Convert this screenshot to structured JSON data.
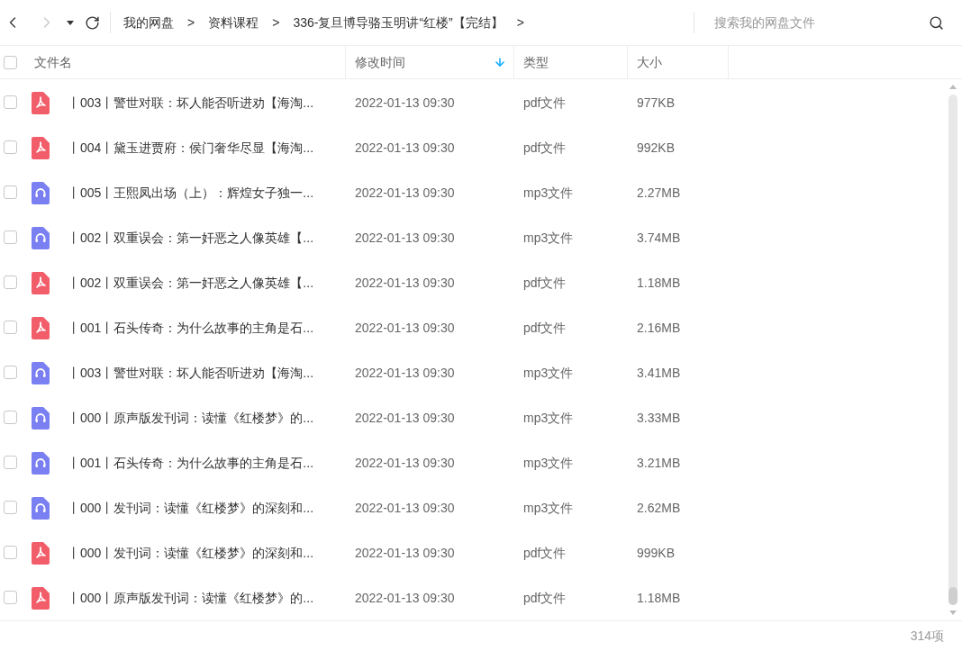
{
  "toolbar": {
    "back": {
      "disabled": false
    },
    "forward": {
      "disabled": true
    },
    "breadcrumbs": [
      {
        "label": "我的网盘",
        "separator": ">"
      },
      {
        "label": "资料课程",
        "separator": ">"
      },
      {
        "label": "336-复旦博导骆玉明讲“红楼”【完结】",
        "separator": ">"
      }
    ],
    "search": {
      "placeholder": "搜索我的网盘文件"
    }
  },
  "table": {
    "select_all": {
      "checked": false
    },
    "columns": [
      {
        "label": "文件名",
        "sorted": false
      },
      {
        "label": "修改时间",
        "sorted": true
      },
      {
        "label": "类型",
        "sorted": false
      },
      {
        "label": "大小",
        "sorted": false
      }
    ],
    "rows": [
      {
        "kind": "pdf",
        "checked": false,
        "name": "丨003丨警世对联：坏人能否听进劝【海淘...",
        "modified": "2022-01-13 09:30",
        "type": "pdf文件",
        "size": "977KB"
      },
      {
        "kind": "pdf",
        "checked": false,
        "name": "丨004丨黛玉进贾府：侯门奢华尽显【海淘...",
        "modified": "2022-01-13 09:30",
        "type": "pdf文件",
        "size": "992KB"
      },
      {
        "kind": "audio",
        "checked": false,
        "name": "丨005丨王熙凤出场（上）：辉煌女子独一...",
        "modified": "2022-01-13 09:30",
        "type": "mp3文件",
        "size": "2.27MB"
      },
      {
        "kind": "audio",
        "checked": false,
        "name": "丨002丨双重误会：第一奸恶之人像英雄【...",
        "modified": "2022-01-13 09:30",
        "type": "mp3文件",
        "size": "3.74MB"
      },
      {
        "kind": "pdf",
        "checked": false,
        "name": "丨002丨双重误会：第一奸恶之人像英雄【...",
        "modified": "2022-01-13 09:30",
        "type": "pdf文件",
        "size": "1.18MB"
      },
      {
        "kind": "pdf",
        "checked": false,
        "name": "丨001丨石头传奇：为什么故事的主角是石...",
        "modified": "2022-01-13 09:30",
        "type": "pdf文件",
        "size": "2.16MB"
      },
      {
        "kind": "audio",
        "checked": false,
        "name": "丨003丨警世对联：坏人能否听进劝【海淘...",
        "modified": "2022-01-13 09:30",
        "type": "mp3文件",
        "size": "3.41MB"
      },
      {
        "kind": "audio",
        "checked": false,
        "name": "丨000丨原声版发刊词：读懂《红楼梦》的...",
        "modified": "2022-01-13 09:30",
        "type": "mp3文件",
        "size": "3.33MB"
      },
      {
        "kind": "audio",
        "checked": false,
        "name": "丨001丨石头传奇：为什么故事的主角是石...",
        "modified": "2022-01-13 09:30",
        "type": "mp3文件",
        "size": "3.21MB"
      },
      {
        "kind": "audio",
        "checked": false,
        "name": "丨000丨发刊词：读懂《红楼梦》的深刻和...",
        "modified": "2022-01-13 09:30",
        "type": "mp3文件",
        "size": "2.62MB"
      },
      {
        "kind": "pdf",
        "checked": false,
        "name": "丨000丨发刊词：读懂《红楼梦》的深刻和...",
        "modified": "2022-01-13 09:30",
        "type": "pdf文件",
        "size": "999KB"
      },
      {
        "kind": "pdf",
        "checked": false,
        "name": "丨000丨原声版发刊词：读懂《红楼梦》的...",
        "modified": "2022-01-13 09:30",
        "type": "pdf文件",
        "size": "1.18MB"
      }
    ]
  },
  "status_bar": {
    "count": "314项"
  }
}
